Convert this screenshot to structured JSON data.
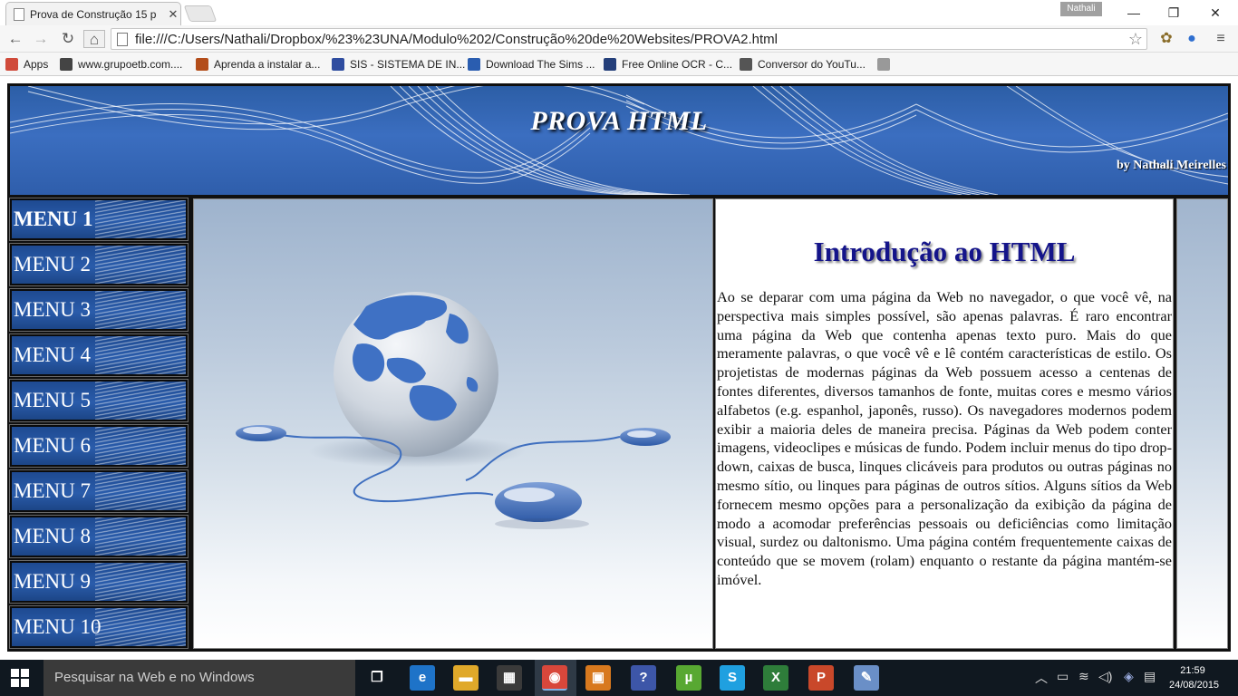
{
  "browser": {
    "tab_title": "Prova de Construção 15 p",
    "user_badge": "Nathali",
    "url": "file:///C:/Users/Nathali/Dropbox/%23%23UNA/Modulo%202/Construção%20de%20Websites/PROVA2.html",
    "bookmarks": [
      {
        "label": "Apps",
        "icon": "apps-grid-icon",
        "color": "#d04a3a"
      },
      {
        "label": "www.grupoetb.com....",
        "icon": "link-icon",
        "color": "#444444"
      },
      {
        "label": "Aprenda a instalar a...",
        "icon": "tt-icon",
        "color": "#b34d1a"
      },
      {
        "label": "SIS - SISTEMA DE IN...",
        "icon": "sis-icon",
        "color": "#2f4da0"
      },
      {
        "label": "Download The Sims ...",
        "icon": "ds-icon",
        "color": "#2a5db0"
      },
      {
        "label": "Free Online OCR - C...",
        "icon": "ocr-icon",
        "color": "#243f7a"
      },
      {
        "label": "Conversor do YouTu...",
        "icon": "converter-icon",
        "color": "#555555"
      },
      {
        "label": "",
        "icon": "page-icon",
        "color": "#999999"
      }
    ]
  },
  "site": {
    "title": "PROVA HTML",
    "byline": "by Nathali Meirelles",
    "menu": [
      "MENU 1",
      "MENU 2",
      "MENU 3",
      "MENU 4",
      "MENU 5",
      "MENU 6",
      "MENU 7",
      "MENU 8",
      "MENU 9",
      "MENU 10"
    ],
    "active_menu": "MENU 1",
    "intro_title": "Introdução ao HTML",
    "intro_text": "Ao se deparar com uma página da Web no navegador, o que você vê, na perspectiva mais simples possível, são apenas palavras. É raro encontrar uma página da Web que contenha apenas texto puro. Mais do que meramente palavras, o que você vê e lê contém características de estilo. Os projetistas de modernas páginas da Web possuem acesso a centenas de fontes diferentes, diversos tamanhos de fonte, muitas cores e mesmo vários alfabetos (e.g. espanhol, japonês, russo). Os navegadores modernos podem exibir a maioria deles de maneira precisa. Páginas da Web podem conter imagens, videoclipes e músicas de fundo. Podem incluir menus do tipo drop-down, caixas de busca, linques clicáveis para produtos ou outras páginas no mesmo sítio, ou linques para páginas de outros sítios. Alguns sítios da Web fornecem mesmo opções para a personalização da exibição da página de modo a acomodar preferências pessoais ou deficiências como limitação visual, surdez ou daltonismo. Uma página contém frequentemente caixas de conteúdo que se movem (rolam) enquanto o restante da página mantém-se imóvel.",
    "brand_color": "#2c5ea6",
    "title_color": "#14148a"
  },
  "taskbar": {
    "search_placeholder": "Pesquisar na Web e no Windows",
    "time": "21:59",
    "date": "24/08/2015",
    "apps": [
      {
        "icon": "task-view-icon",
        "glyph": "❐",
        "color": "transparent"
      },
      {
        "icon": "edge-icon",
        "glyph": "e",
        "color": "#1e73c8"
      },
      {
        "icon": "file-explorer-icon",
        "glyph": "▬",
        "color": "#e0a92a"
      },
      {
        "icon": "store-icon",
        "glyph": "▦",
        "color": "#3a3a3a"
      },
      {
        "icon": "chrome-icon",
        "glyph": "◉",
        "color": "#d8473b"
      },
      {
        "icon": "office-icon",
        "glyph": "▣",
        "color": "#d8791e"
      },
      {
        "icon": "help-icon",
        "glyph": "?",
        "color": "#3d56a8"
      },
      {
        "icon": "utorrent-icon",
        "glyph": "µ",
        "color": "#58a832"
      },
      {
        "icon": "skype-icon",
        "glyph": "S",
        "color": "#1fa0e0"
      },
      {
        "icon": "excel-icon",
        "glyph": "X",
        "color": "#2e7d3a"
      },
      {
        "icon": "powerpoint-icon",
        "glyph": "P",
        "color": "#c9482a"
      },
      {
        "icon": "paint-icon",
        "glyph": "✎",
        "color": "#6a8fc7"
      }
    ]
  }
}
